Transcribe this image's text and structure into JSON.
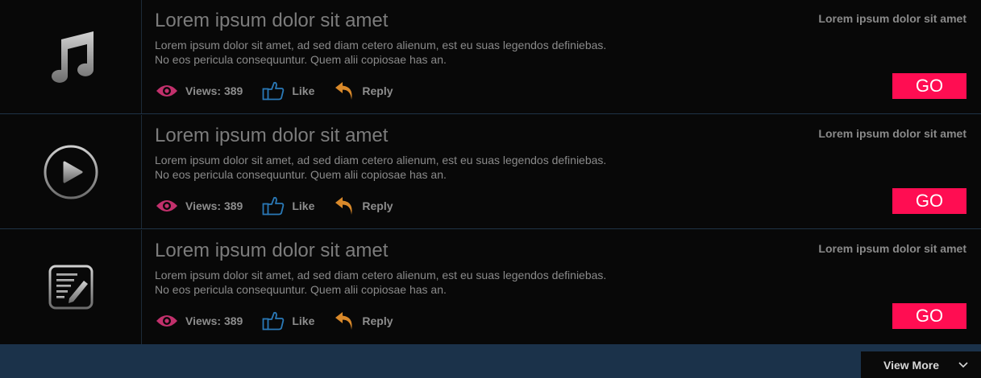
{
  "items": [
    {
      "icon": "music-note-icon",
      "title": "Lorem ipsum dolor sit amet",
      "desc_line1": "Lorem ipsum dolor sit amet, ad sed diam cetero alienum, est eu suas legendos definiebas.",
      "desc_line2": "No eos pericula consequuntur. Quem alii copiosae has an.",
      "meta": "Lorem ipsum dolor sit amet",
      "views_label": "Views: 389",
      "like_label": "Like",
      "reply_label": "Reply",
      "go_label": "GO"
    },
    {
      "icon": "play-circle-icon",
      "title": "Lorem ipsum dolor sit amet",
      "desc_line1": "Lorem ipsum dolor sit amet, ad sed diam cetero alienum, est eu suas legendos definiebas.",
      "desc_line2": "No eos pericula consequuntur. Quem alii copiosae has an.",
      "meta": "Lorem ipsum dolor sit amet",
      "views_label": "Views: 389",
      "like_label": "Like",
      "reply_label": "Reply",
      "go_label": "GO"
    },
    {
      "icon": "edit-note-icon",
      "title": "Lorem ipsum dolor sit amet",
      "desc_line1": "Lorem ipsum dolor sit amet, ad sed diam cetero alienum, est eu suas legendos definiebas.",
      "desc_line2": "No eos pericula consequuntur. Quem alii copiosae has an.",
      "meta": "Lorem ipsum dolor sit amet",
      "views_label": "Views: 389",
      "like_label": "Like",
      "reply_label": "Reply",
      "go_label": "GO"
    }
  ],
  "view_more": {
    "label": "View More",
    "icon": "chevron-down-icon"
  },
  "colors": {
    "accent": "#ff0d52",
    "eye": "#c2306c",
    "like": "#2a79b7",
    "reply": "#d9892a",
    "page_bg": "#1b324a"
  }
}
